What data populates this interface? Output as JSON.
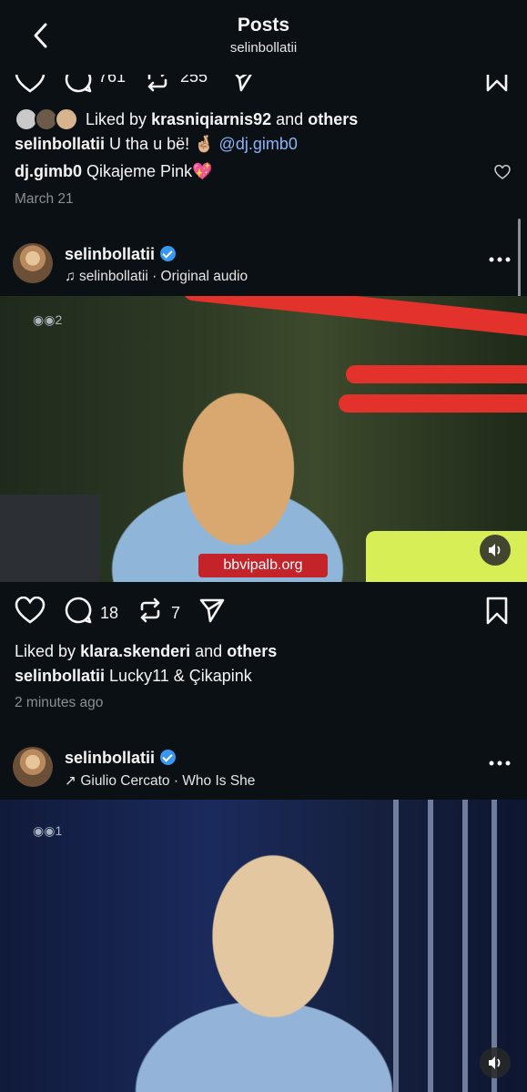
{
  "header": {
    "title": "Posts",
    "subtitle": "selinbollatii"
  },
  "prev_post": {
    "comments": "761",
    "reposts": "255",
    "liked_prefix": "Liked by",
    "liked_user": "krasniqiarnis92",
    "liked_and": "and",
    "liked_others": "others",
    "caption_user": "selinbollatii",
    "caption_text": "U tha u bë! 🤞🏼",
    "caption_mention": "@dj.gimb0",
    "comment_user": "dj.gimb0",
    "comment_text": "Qikajeme Pink💖",
    "date": "March 21"
  },
  "post1": {
    "username": "selinbollatii",
    "audio": "selinbollatii · Original audio",
    "watermark": "bbvipalb.org",
    "channel_badge": "2",
    "comments": "18",
    "reposts": "7",
    "liked_prefix": "Liked by",
    "liked_user": "klara.skenderi",
    "liked_and": "and",
    "liked_others": "others",
    "caption_user": "selinbollatii",
    "caption_text": "Lucky11 & Çikapink",
    "date": "2 minutes ago"
  },
  "post2": {
    "username": "selinbollatii",
    "audio": "Giulio Cercato · Who Is She",
    "channel_badge": "1"
  },
  "icons": {
    "back": "chevron-left-icon",
    "heart": "heart-icon",
    "comment": "comment-icon",
    "repost": "repost-icon",
    "share": "send-icon",
    "save": "bookmark-icon",
    "more": "more-dots-icon",
    "music": "music-note-icon",
    "sound": "speaker-icon",
    "verified": "verified-badge-icon"
  },
  "colors": {
    "background": "#0b1014",
    "link": "#8ab4f8",
    "verified": "#3897f0",
    "muted": "#8a8f94"
  }
}
